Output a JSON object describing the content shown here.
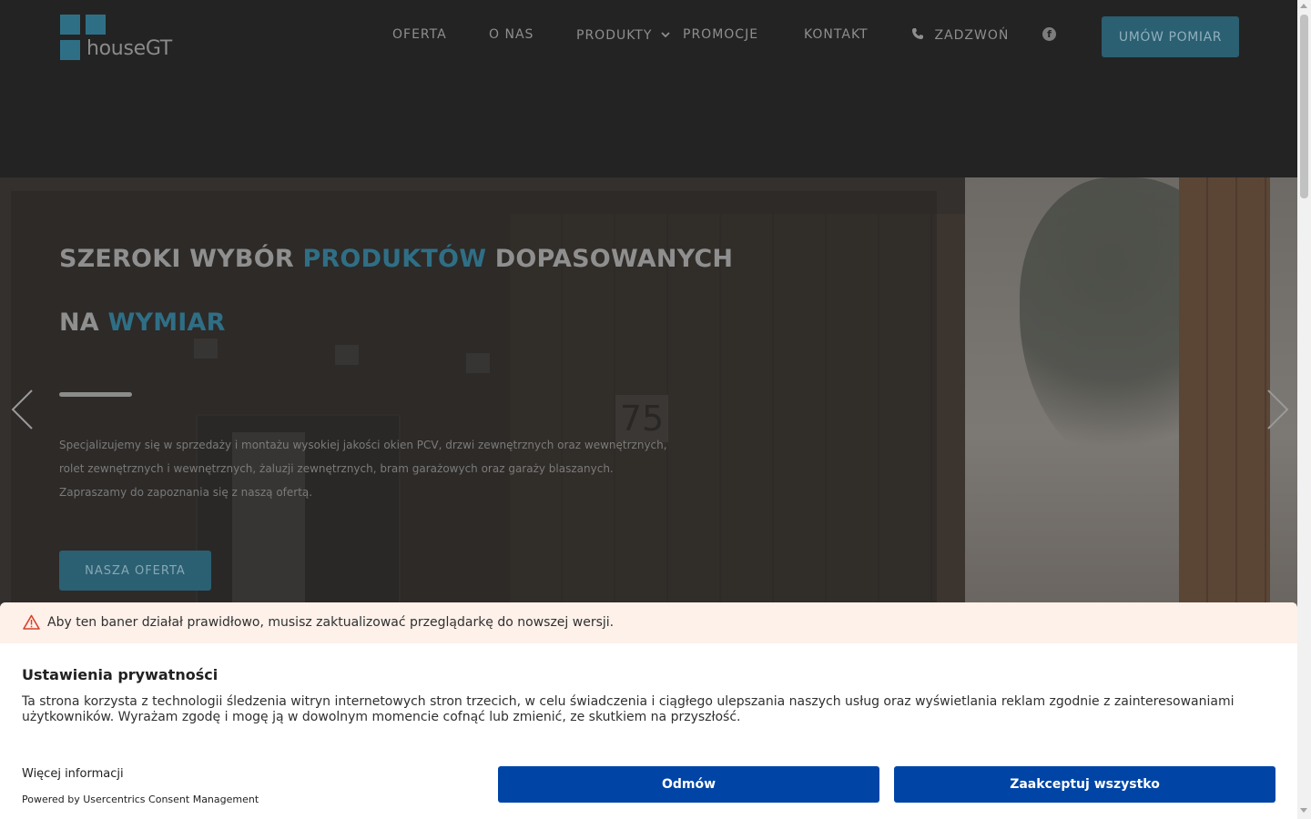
{
  "logo": {
    "text": "houseGT",
    "icon": "four-squares-logo"
  },
  "nav": {
    "items": [
      {
        "label": "OFERTA"
      },
      {
        "label": "O NAS"
      },
      {
        "label": "PRODUKTY",
        "icon": "chevron-down-icon"
      },
      {
        "label": "PROMOCJE"
      },
      {
        "label": "KONTAKT"
      },
      {
        "label": "ZADZWOŃ",
        "icon": "phone-icon"
      }
    ],
    "facebook_icon": "facebook-icon",
    "cta_label": "UMÓW POMIAR"
  },
  "hero": {
    "title_line1": {
      "a": "SZEROKI WYBÓR ",
      "b": "PRODUKTÓW",
      "c": " DOPASOWANYCH"
    },
    "title_line2": {
      "a": "NA ",
      "b": "WYMIAR"
    },
    "text_lines": [
      "Specjalizujemy się w sprzedaży i montażu wysokiej jakości okien PCV, drzwi zewnętrznych oraz wewnętrznych,",
      "rolet zewnętrznych i wewnętrznych, żaluzji zewnętrznych, bram garażowych oraz garaży blaszanych.",
      "Zapraszamy do zapoznania się z naszą ofertą."
    ],
    "cta_label": "NASZA OFERTA",
    "house_number": "75",
    "prev_icon": "chevron-left-icon",
    "next_icon": "chevron-right-icon"
  },
  "consent": {
    "warning": "Aby ten baner działał prawidłowo, musisz zaktualizować przeglądarkę do nowszej wersji.",
    "title": "Ustawienia prywatności",
    "body": "Ta strona korzysta z technologii śledzenia witryn internetowych stron trzecich, w celu świadczenia i ciągłego ulepszania naszych usług oraz wyświetlania reklam zgodnie z zainteresowaniami użytkowników. Wyrażam zgodę i mogę ją w dowolnym momencie cofnąć lub zmienić, ze skutkiem na przyszłość.",
    "more_info": "Więcej informacji",
    "powered_by": "Powered by Usercentrics Consent Management",
    "deny_label": "Odmów",
    "accept_label": "Zaakceptuj wszystko"
  },
  "colors": {
    "header_bg": "#232323",
    "accent": "#2f6f86",
    "consent_button": "#0045a5",
    "warning_bg": "#fdf1ea"
  }
}
